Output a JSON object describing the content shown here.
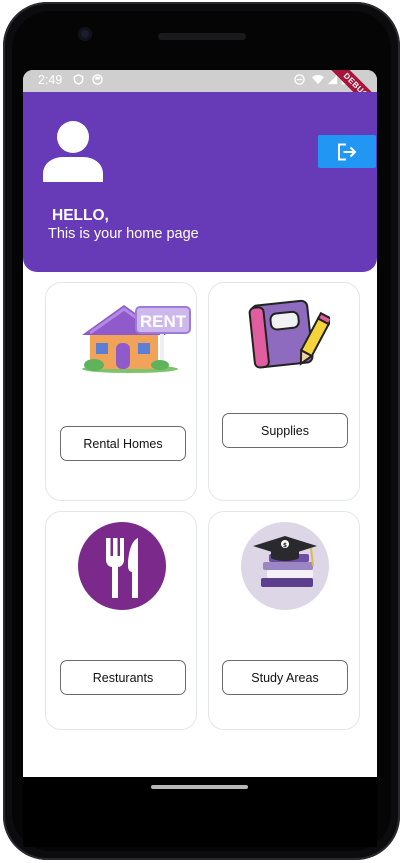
{
  "statusbar": {
    "time": "2:49",
    "debug_banner": "DEBUG"
  },
  "header": {
    "greeting": "HELLO,",
    "subtitle": "This is your home page",
    "colors": {
      "background": "#673ab7",
      "logout_button": "#2196f3"
    },
    "avatar_icon": "person-icon",
    "logout_icon": "logout-icon"
  },
  "cards": [
    {
      "label": "Rental Homes",
      "icon": "rent-house-icon"
    },
    {
      "label": "Supplies",
      "icon": "notebook-pencil-icon"
    },
    {
      "label": "Resturants",
      "icon": "fork-knife-icon"
    },
    {
      "label": "Study Areas",
      "icon": "books-graduation-cap-icon"
    }
  ]
}
